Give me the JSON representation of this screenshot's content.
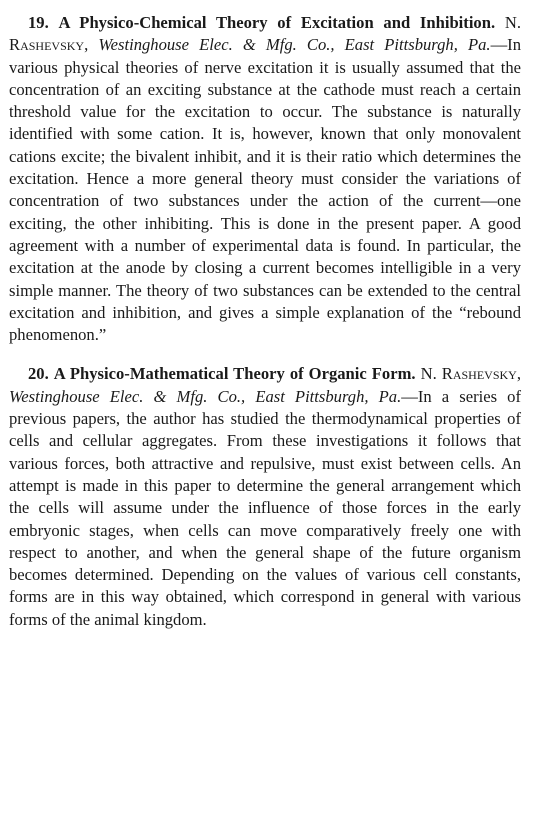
{
  "abstracts": [
    {
      "number": "19.",
      "title": "A Physico-Chemical Theory of Excitation and Inhibition.",
      "author": "N. Rashevsky,",
      "affiliation": "Westinghouse Elec. & Mfg. Co., East Pittsburgh, Pa.",
      "body": "—In various physical theories of nerve excitation it is usually assumed that the concentration of an exciting substance at the cathode must reach a certain threshold value for the excitation to occur. The substance is naturally identified with some cation. It is, however, known that only monovalent cations excite; the bivalent inhibit, and it is their ratio which determines the excitation. Hence a more general theory must consider the variations of concentration of two substances under the action of the current—one exciting, the other inhibiting. This is done in the present paper. A good agreement with a number of experimental data is found. In particular, the excitation at the anode by closing a current becomes intelligible in a very simple manner. The theory of two substances can be extended to the central excitation and inhibition, and gives a simple explanation of the “rebound phenomenon.”"
    },
    {
      "number": "20.",
      "title": "A Physico-Mathematical Theory of Organic Form.",
      "author": "N. Rashevsky,",
      "affiliation": "Westinghouse Elec. & Mfg. Co., East Pittsburgh, Pa.",
      "body": "—In a series of previous papers, the author has studied the thermodynamical properties of cells and cellular aggregates. From these investigations it follows that various forces, both attractive and repulsive, must exist between cells. An attempt is made in this paper to determine the general arrangement which the cells will assume under the influence of those forces in the early embryonic stages, when cells can move comparatively freely one with respect to another, and when the general shape of the future organism becomes determined. Depending on the values of various cell constants, forms are in this way obtained, which correspond in general with various forms of the animal kingdom."
    }
  ]
}
